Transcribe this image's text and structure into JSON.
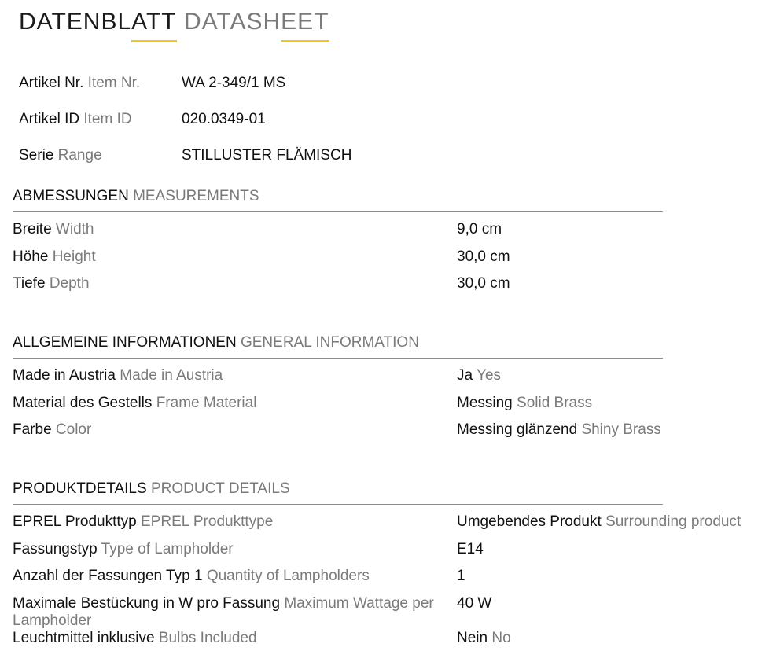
{
  "title": {
    "de": "DATENBLATT",
    "en": "DATASHEET"
  },
  "info": [
    {
      "label_de": "Artikel Nr.",
      "label_en": "Item Nr.",
      "value": "WA 2-349/1 MS"
    },
    {
      "label_de": "Artikel ID",
      "label_en": "Item ID",
      "value": "020.0349-01"
    },
    {
      "label_de": "Serie",
      "label_en": "Range",
      "value": "STILLUSTER FLÄMISCH"
    }
  ],
  "measurements": {
    "title_de": "ABMESSUNGEN",
    "title_en": "MEASUREMENTS",
    "rows": [
      {
        "label_de": "Breite",
        "label_en": "Width",
        "value_de": "9,0 cm",
        "value_en": ""
      },
      {
        "label_de": "Höhe",
        "label_en": "Height",
        "value_de": "30,0 cm",
        "value_en": ""
      },
      {
        "label_de": "Tiefe",
        "label_en": "Depth",
        "value_de": "30,0 cm",
        "value_en": ""
      }
    ]
  },
  "general": {
    "title_de": "ALLGEMEINE INFORMATIONEN",
    "title_en": "GENERAL INFORMATION",
    "rows": [
      {
        "label_de": "Made in Austria",
        "label_en": "Made in Austria",
        "value_de": "Ja",
        "value_en": "Yes"
      },
      {
        "label_de": "Material des Gestells",
        "label_en": "Frame Material",
        "value_de": "Messing",
        "value_en": "Solid Brass"
      },
      {
        "label_de": "Farbe",
        "label_en": "Color",
        "value_de": "Messing glänzend",
        "value_en": "Shiny Brass"
      }
    ]
  },
  "product": {
    "title_de": "PRODUKTDETAILS",
    "title_en": "PRODUCT DETAILS",
    "rows": [
      {
        "label_de": "EPREL Produkttyp",
        "label_en": "EPREL Produkttype",
        "value_de": "Umgebendes Produkt",
        "value_en": "Surrounding product"
      },
      {
        "label_de": "Fassungstyp",
        "label_en": "Type of Lampholder",
        "value_de": "E14",
        "value_en": ""
      },
      {
        "label_de": "Anzahl der Fassungen Typ 1",
        "label_en": "Quantity of Lampholders",
        "value_de": "1",
        "value_en": ""
      },
      {
        "label_de": "Maximale Bestückung in W pro Fassung",
        "label_en": "Maximum Wattage per Lampholder",
        "value_de": "40 W",
        "value_en": ""
      },
      {
        "label_de": "Leuchtmittel inklusive",
        "label_en": "Bulbs Included",
        "value_de": "Nein",
        "value_en": "No"
      }
    ]
  },
  "colors": {
    "accent": "#f2c811",
    "secondary_text": "#7a7a7a",
    "rule": "#8c8c8c"
  }
}
